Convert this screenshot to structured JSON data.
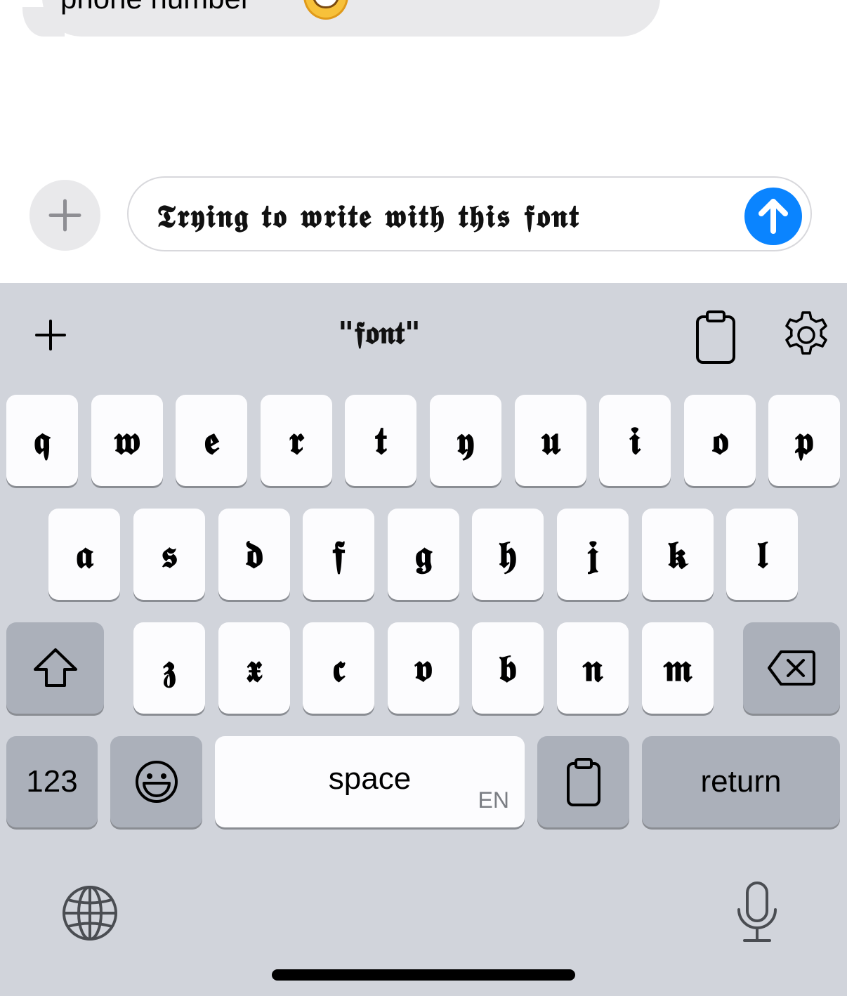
{
  "conversation": {
    "received_message_text": "phone number",
    "received_message_emoji": "grinning-face"
  },
  "composer": {
    "add_button_icon": "plus-icon",
    "input_text": "𝕿𝖗𝖞𝖎𝖓𝖌 𝖙𝖔 𝖜𝖗𝖎𝖙𝖊 𝖜𝖎𝖙𝖍 𝖙𝖍𝖎𝖘 𝖋𝖔𝖓𝖙",
    "send_button_icon": "arrow-up-icon",
    "send_color": "#0a84ff"
  },
  "keyboard_toolbar": {
    "left_icon": "plus-icon",
    "suggestion": "\"𝖋𝖔𝖓𝖙\"",
    "clipboard_icon": "clipboard-icon",
    "settings_icon": "gear-icon"
  },
  "keyboard": {
    "row1": [
      "𝖖",
      "𝖜",
      "𝖊",
      "𝖗",
      "𝖙",
      "𝖞",
      "𝖚",
      "𝖎",
      "𝖔",
      "𝖕"
    ],
    "row2": [
      "𝖆",
      "𝖘",
      "𝖉",
      "𝖋",
      "𝖌",
      "𝖍",
      "𝖏",
      "𝖐",
      "𝖑"
    ],
    "row3": [
      "𝖟",
      "𝖝",
      "𝖈",
      "𝖛",
      "𝖇",
      "𝖓",
      "𝖒"
    ],
    "shift_icon": "shift-icon",
    "delete_icon": "backspace-icon",
    "numbers_label": "123",
    "emoji_icon": "emoji-icon",
    "space_label": "space",
    "space_language": "EN",
    "clipboard_key_icon": "clipboard-icon",
    "return_label": "return",
    "globe_icon": "globe-icon",
    "mic_icon": "microphone-icon",
    "key_color": "#fcfcfe",
    "dark_key_color": "#abb0ba",
    "background_color": "#d1d4db"
  }
}
